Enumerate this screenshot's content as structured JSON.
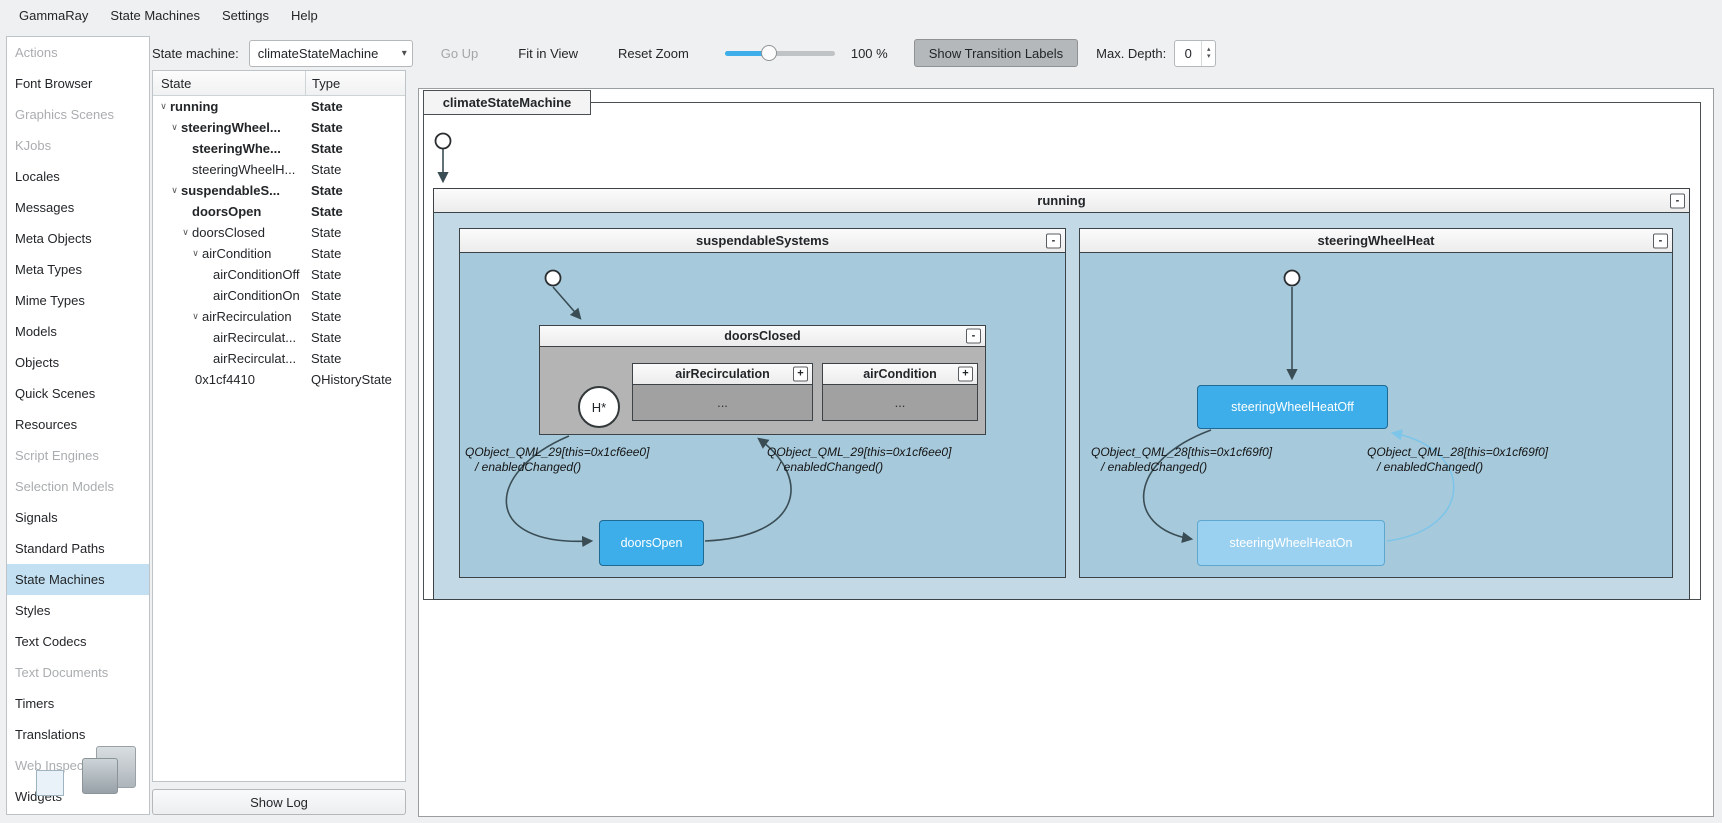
{
  "colors": {
    "accent": "#3daee9",
    "selection_bg": "#c2e0f2",
    "running_fill": "#c3d9e5",
    "region_fill": "#a6c9db",
    "collapsed_region_fill": "#b4b4b4",
    "active_state_fill": "#3daee9",
    "inactive_state_fill": "#9bd1f0"
  },
  "icons": {
    "chevron_down": "∨",
    "combo_arrow": "▾",
    "spin_up": "▴",
    "spin_down": "▾"
  },
  "menubar": {
    "items": [
      {
        "label": "GammaRay"
      },
      {
        "label": "State Machines"
      },
      {
        "label": "Settings"
      },
      {
        "label": "Help"
      }
    ]
  },
  "sidebar": {
    "items": [
      {
        "label": "Actions"
      },
      {
        "label": "Font Browser"
      },
      {
        "label": "Graphics Scenes"
      },
      {
        "label": "KJobs"
      },
      {
        "label": "Locales"
      },
      {
        "label": "Messages"
      },
      {
        "label": "Meta Objects"
      },
      {
        "label": "Meta Types"
      },
      {
        "label": "Mime Types"
      },
      {
        "label": "Models"
      },
      {
        "label": "Objects"
      },
      {
        "label": "Quick Scenes"
      },
      {
        "label": "Resources"
      },
      {
        "label": "Script Engines"
      },
      {
        "label": "Selection Models"
      },
      {
        "label": "Signals"
      },
      {
        "label": "Standard Paths"
      },
      {
        "label": "State Machines"
      },
      {
        "label": "Styles"
      },
      {
        "label": "Text Codecs"
      },
      {
        "label": "Text Documents"
      },
      {
        "label": "Timers"
      },
      {
        "label": "Translations"
      },
      {
        "label": "Web Inspector"
      },
      {
        "label": "Widgets"
      }
    ]
  },
  "toolbar": {
    "state_machine_label": "State machine:",
    "state_machine_value": "climateStateMachine",
    "go_up": "Go Up",
    "fit_in_view": "Fit in View",
    "reset_zoom": "Reset Zoom",
    "zoom_value": "100 %",
    "show_transition_labels": "Show Transition Labels",
    "max_depth_label": "Max. Depth:",
    "max_depth_value": "0"
  },
  "tree": {
    "columns": {
      "state": "State",
      "type": "Type"
    },
    "rows": [
      {
        "state": "running",
        "type": "State"
      },
      {
        "state": "steeringWheel...",
        "type": "State"
      },
      {
        "state": "steeringWhe...",
        "type": "State"
      },
      {
        "state": "steeringWheelH...",
        "type": "State"
      },
      {
        "state": "suspendableS...",
        "type": "State"
      },
      {
        "state": "doorsOpen",
        "type": "State"
      },
      {
        "state": "doorsClosed",
        "type": "State"
      },
      {
        "state": "airCondition",
        "type": "State"
      },
      {
        "state": "airConditionOff",
        "type": "State"
      },
      {
        "state": "airConditionOn",
        "type": "State"
      },
      {
        "state": "airRecirculation",
        "type": "State"
      },
      {
        "state": "airRecirculat...",
        "type": "State"
      },
      {
        "state": "airRecirculat...",
        "type": "State"
      },
      {
        "state": "0x1cf4410",
        "type": "QHistoryState"
      }
    ]
  },
  "bottom": {
    "show_log": "Show Log"
  },
  "diagram": {
    "root_label": "climateStateMachine",
    "collapse_glyph": "-",
    "expand_glyph": "+",
    "ellipsis": "...",
    "history_label": "H*",
    "states": {
      "running": "running",
      "suspendable_systems": "suspendableSystems",
      "steering_wheel_heat": "steeringWheelHeat",
      "doors_closed": "doorsClosed",
      "air_recirculation": "airRecirculation",
      "air_condition": "airCondition",
      "doors_open": "doorsOpen",
      "steering_wheel_heat_off": "steeringWheelHeatOff",
      "steering_wheel_heat_on": "steeringWheelHeatOn"
    },
    "transitions": {
      "qml29_line1": "QObject_QML_29[this=0x1cf6ee0]",
      "qml29_line2": "/ enabledChanged()",
      "qml28_line1": "QObject_QML_28[this=0x1cf69f0]",
      "qml28_line2": "/ enabledChanged()"
    }
  }
}
